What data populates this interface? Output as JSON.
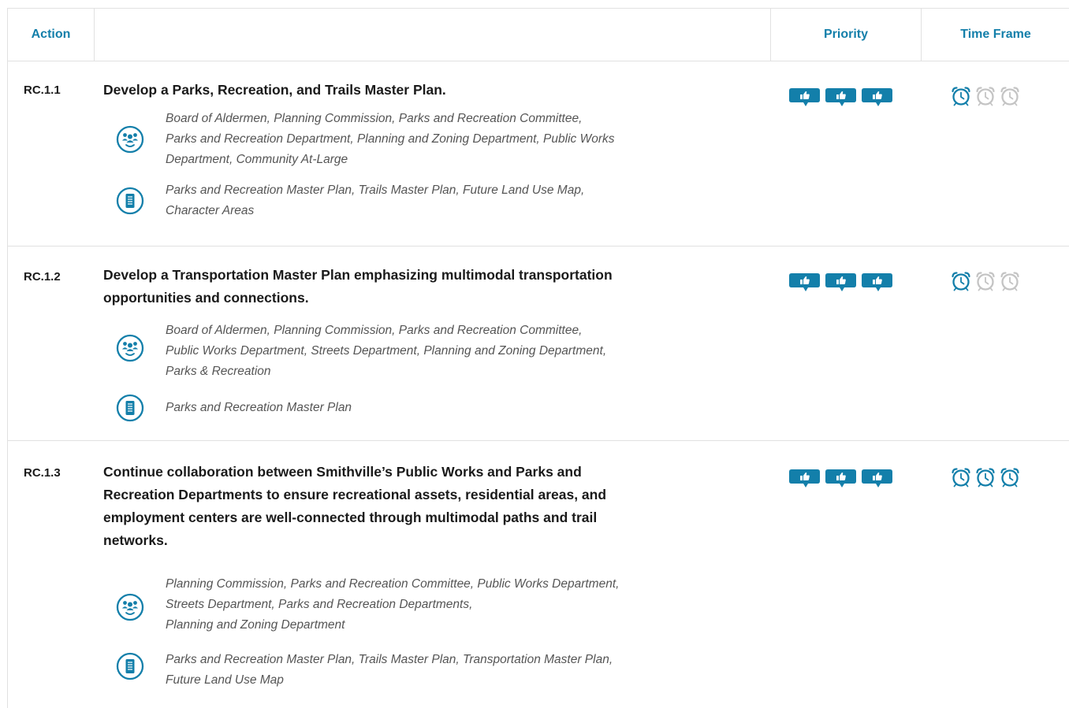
{
  "header": {
    "action": "Action",
    "priority": "Priority",
    "time_frame": "Time Frame"
  },
  "colors": {
    "accent": "#137faa",
    "clock_active": "#137faa",
    "clock_inactive": "#c4c4c4",
    "border": "#e1e1e1"
  },
  "icons": {
    "priority": "thumbs-up-icon",
    "time_frame": "alarm-clock-icon",
    "stakeholders": "people-group-icon",
    "resources": "document-list-icon"
  },
  "rows": [
    {
      "code": "RC.1.1",
      "title_lines": [
        "Develop a Parks, Recreation, and Trails Master Plan."
      ],
      "stakeholders_lines": [
        "Board of Aldermen, Planning Commission, Parks and Recreation Committee,",
        "Parks and Recreation Department, Planning and Zoning Department, Public Works",
        "Department, Community At-Large"
      ],
      "resources_lines": [
        "Parks and Recreation Master Plan, Trails Master Plan, Future Land Use Map,",
        "Character Areas"
      ],
      "priority": 3,
      "time_frame": 1
    },
    {
      "code": "RC.1.2",
      "title_lines": [
        "Develop a Transportation Master Plan emphasizing multimodal transportation",
        "opportunities and connections."
      ],
      "stakeholders_lines": [
        "Board of Aldermen, Planning Commission, Parks and Recreation Committee,",
        "Public Works Department, Streets Department, Planning and Zoning Department,",
        "Parks & Recreation"
      ],
      "resources_lines": [
        "Parks and Recreation Master Plan"
      ],
      "priority": 3,
      "time_frame": 1
    },
    {
      "code": "RC.1.3",
      "title_lines": [
        "Continue collaboration between Smithville’s Public Works and Parks and",
        "Recreation Departments to ensure recreational assets, residential areas, and",
        "employment centers are well-connected through multimodal paths and trail",
        "networks."
      ],
      "stakeholders_lines": [
        "Planning Commission, Parks and Recreation Committee, Public Works Department,",
        "Streets Department, Parks and Recreation Departments,",
        "Planning and Zoning Department"
      ],
      "resources_lines": [
        "Parks and Recreation Master Plan, Trails Master Plan, Transportation Master Plan,",
        "Future Land Use Map"
      ],
      "priority": 3,
      "time_frame": 3
    }
  ]
}
